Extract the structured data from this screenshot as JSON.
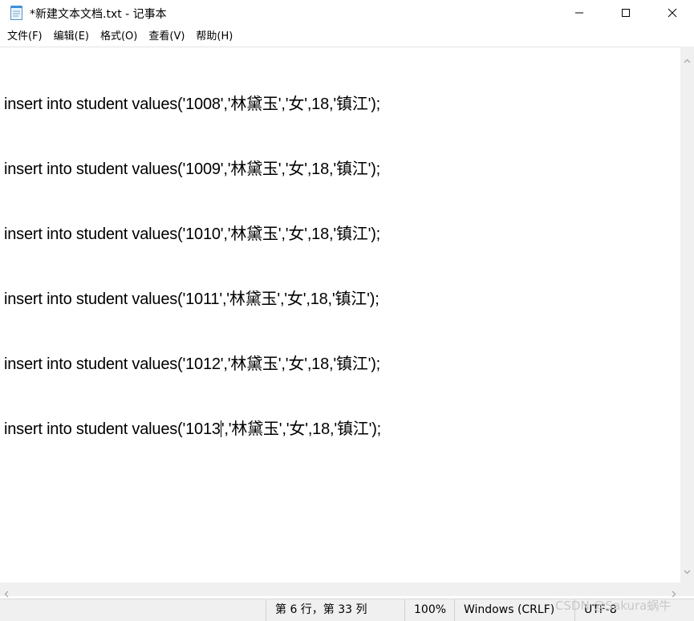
{
  "window": {
    "title": "*新建文本文档.txt - 记事本",
    "icons": {
      "app": "notepad-icon",
      "minimize": "minimize-icon",
      "maximize": "maximize-icon",
      "close": "close-icon"
    }
  },
  "menu": [
    {
      "label": "文件(F)"
    },
    {
      "label": "编辑(E)"
    },
    {
      "label": "格式(O)"
    },
    {
      "label": "查看(V)"
    },
    {
      "label": "帮助(H)"
    }
  ],
  "editor": {
    "lines": [
      "insert into student values('1008','林黛玉','女',18,'镇江');",
      "insert into student values('1009','林黛玉','女',18,'镇江');",
      "insert into student values('1010','林黛玉','女',18,'镇江');",
      "insert into student values('1011','林黛玉','女',18,'镇江');",
      "insert into student values('1012','林黛玉','女',18,'镇江');"
    ],
    "caret_line": {
      "before": "insert into student values('1013",
      "after": "','林黛玉','女',18,'镇江');"
    }
  },
  "status": {
    "position": "第 6 行，第 33 列",
    "zoom": "100%",
    "line_ending": "Windows (CRLF)",
    "encoding": "UTF-8"
  },
  "watermark": "CSDN @Sakura蜗牛"
}
